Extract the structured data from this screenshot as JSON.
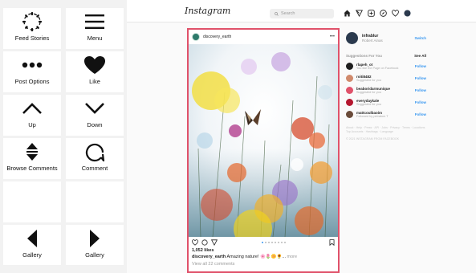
{
  "controls": [
    {
      "label": "Feed Stories",
      "icon": "loading-circle-icon"
    },
    {
      "label": "Menu",
      "icon": "hamburger-menu-icon"
    },
    {
      "label": "Post Options",
      "icon": "three-dots-icon"
    },
    {
      "label": "Like",
      "icon": "heart-icon"
    },
    {
      "label": "Up",
      "icon": "chevron-up-icon"
    },
    {
      "label": "Down",
      "icon": "chevron-down-icon"
    },
    {
      "label": "Browse Comments",
      "icon": "up-down-arrows-icon"
    },
    {
      "label": "Comment",
      "icon": "comment-bubble-icon"
    },
    {
      "label": "Gallery",
      "icon": "triangle-left-icon"
    },
    {
      "label": "Gallery",
      "icon": "triangle-right-icon"
    }
  ],
  "instagram": {
    "logo": "Instagram",
    "search_placeholder": "Search",
    "post": {
      "username": "discovery_earth",
      "likes": "1,052 likes",
      "caption_user": "discovery_earth",
      "caption_text": "Amazing nature! 🌸🌷🌼🌻...",
      "caption_more": "more",
      "comments": "View all 22 comments"
    },
    "sidebar": {
      "user_handle": "infrablur",
      "user_name": "Robert Ainas",
      "switch": "Switch",
      "suggestions_title": "Suggestions For You",
      "see_all": "See All",
      "suggestions": [
        {
          "name": "rlapeh_ot",
          "sub": "You like the Page on Facebook",
          "follow": "Follow",
          "color": "#1f1f1f"
        },
        {
          "name": "roiti8482",
          "sub": "Suggested for you",
          "follow": "Follow",
          "color": "#d08a6c"
        },
        {
          "name": "beaboridarmunique",
          "sub": "Suggested for you",
          "follow": "Follow",
          "color": "#e0526a"
        },
        {
          "name": "everydaykale",
          "sub": "Suggested for you",
          "follow": "Follow",
          "color": "#b5172f"
        },
        {
          "name": "mattcoulbaoim",
          "sub": "Followed by petratom T",
          "follow": "Follow",
          "color": "#6a4b3a"
        }
      ],
      "footer_line1": "About · Help · Press · API · Jobs · Privacy · Terms · Locations",
      "footer_line2": "Top Accounts · Hashtags · Language",
      "footer_line3": "© 2021 INSTAGRAM FROM FACEBOOK"
    }
  },
  "colors": {
    "accent": "#e0526a",
    "link": "#3897f0"
  }
}
